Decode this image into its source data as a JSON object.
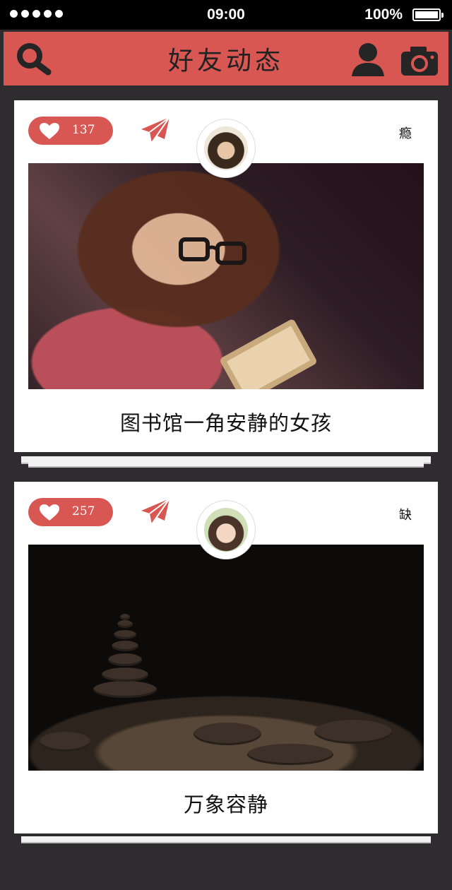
{
  "status_bar": {
    "time": "09:00",
    "battery_percent": "100%",
    "signal_icon": "signal-dots-icon",
    "battery_icon": "battery-icon"
  },
  "header": {
    "title": "好友动态",
    "icons": [
      "search-icon",
      "user-icon",
      "camera-icon"
    ],
    "accent_color": "#d85752"
  },
  "feed": [
    {
      "likes": "137",
      "username": "瘾",
      "caption": "图书馆一角安静的女孩",
      "avatar_icon": "profile-avatar-icon",
      "photo_subject": "reading-girl-photo"
    },
    {
      "likes": "257",
      "username": "缺",
      "caption": "万象容静",
      "avatar_icon": "profile-avatar-icon",
      "photo_subject": "stacked-stones-beach-photo"
    }
  ]
}
